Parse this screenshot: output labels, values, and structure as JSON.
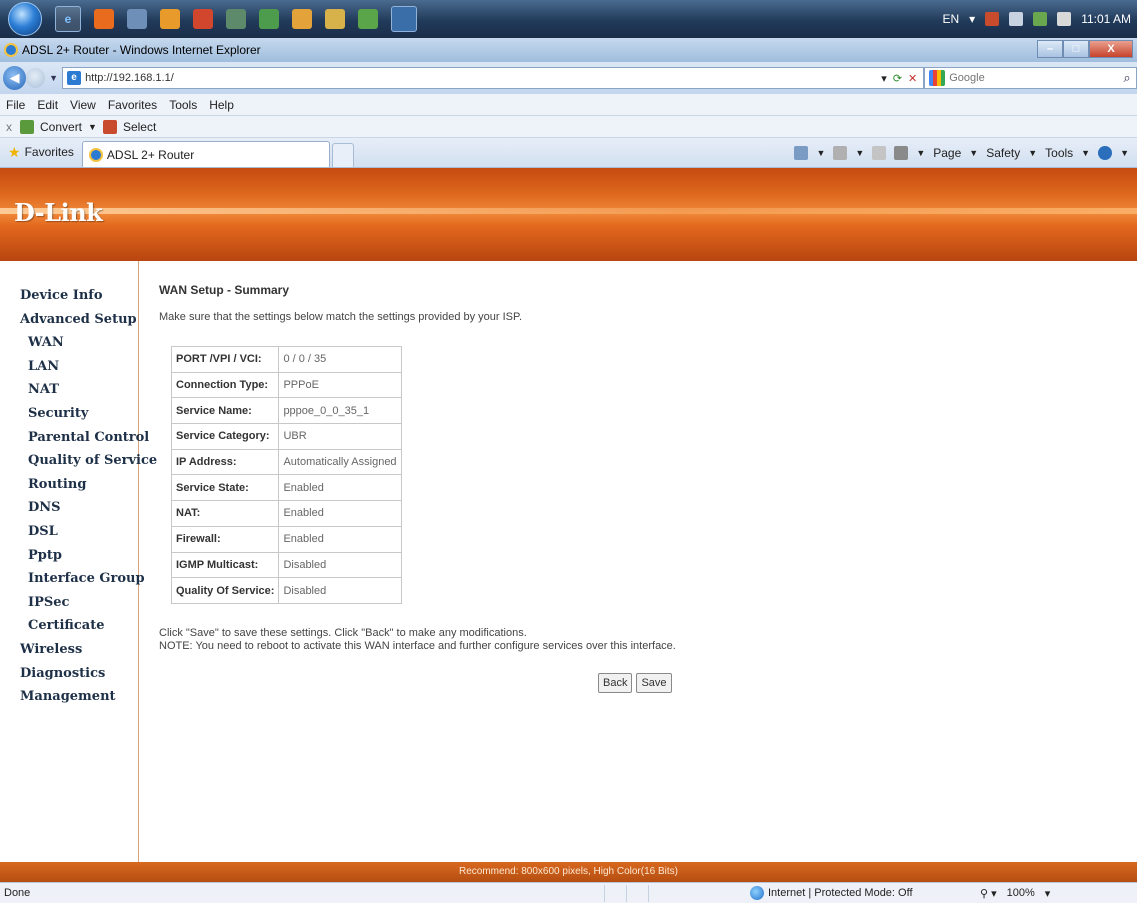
{
  "taskbar": {
    "tray_lang": "EN",
    "clock": "11:01 AM"
  },
  "window": {
    "title": "ADSL 2+ Router - Windows Internet Explorer",
    "minimize": "–",
    "maximize": "□",
    "close": "X"
  },
  "address_bar": {
    "url": "http://192.168.1.1/",
    "search_placeholder": "Google"
  },
  "menu": {
    "items": [
      "File",
      "Edit",
      "View",
      "Favorites",
      "Tools",
      "Help"
    ]
  },
  "toolbar2": {
    "close": "x",
    "convert": "Convert",
    "select": "Select"
  },
  "favbar": {
    "favorites": "Favorites",
    "tab_title": "ADSL 2+ Router",
    "page": "Page",
    "safety": "Safety",
    "tools": "Tools"
  },
  "brand": {
    "logo": "D-Link"
  },
  "sidebar": {
    "items": [
      {
        "label": "Device Info",
        "sub": false
      },
      {
        "label": "Advanced Setup",
        "sub": false
      },
      {
        "label": "WAN",
        "sub": true
      },
      {
        "label": "LAN",
        "sub": true
      },
      {
        "label": "NAT",
        "sub": true
      },
      {
        "label": "Security",
        "sub": true
      },
      {
        "label": "Parental Control",
        "sub": true
      },
      {
        "label": "Quality of Service",
        "sub": true
      },
      {
        "label": "Routing",
        "sub": true
      },
      {
        "label": "DNS",
        "sub": true
      },
      {
        "label": "DSL",
        "sub": true
      },
      {
        "label": "Pptp",
        "sub": true
      },
      {
        "label": "Interface Group",
        "sub": true
      },
      {
        "label": "IPSec",
        "sub": true
      },
      {
        "label": "Certificate",
        "sub": true
      },
      {
        "label": "Wireless",
        "sub": false
      },
      {
        "label": "Diagnostics",
        "sub": false
      },
      {
        "label": "Management",
        "sub": false
      }
    ]
  },
  "main": {
    "title": "WAN Setup - Summary",
    "intro": "Make sure that the settings below match the settings provided by your ISP.",
    "summary": [
      {
        "key": "PORT /VPI / VCI:",
        "value": "0 / 0 / 35"
      },
      {
        "key": "Connection Type:",
        "value": "PPPoE"
      },
      {
        "key": "Service Name:",
        "value": "pppoe_0_0_35_1"
      },
      {
        "key": "Service Category:",
        "value": "UBR"
      },
      {
        "key": "IP Address:",
        "value": "Automatically Assigned"
      },
      {
        "key": "Service State:",
        "value": "Enabled"
      },
      {
        "key": "NAT:",
        "value": "Enabled"
      },
      {
        "key": "Firewall:",
        "value": "Enabled"
      },
      {
        "key": "IGMP Multicast:",
        "value": "Disabled"
      },
      {
        "key": "Quality Of Service:",
        "value": "Disabled"
      }
    ],
    "note_line1": "Click \"Save\" to save these settings. Click \"Back\" to make any modifications.",
    "note_line2": "NOTE: You need to reboot to activate this WAN interface and further configure services over this interface.",
    "back_label": "Back",
    "save_label": "Save"
  },
  "footer": {
    "recommend": "Recommend: 800x600 pixels, High Color(16 Bits)"
  },
  "statusbar": {
    "status": "Done",
    "zone": "Internet | Protected Mode: Off",
    "zoom": "100%"
  }
}
